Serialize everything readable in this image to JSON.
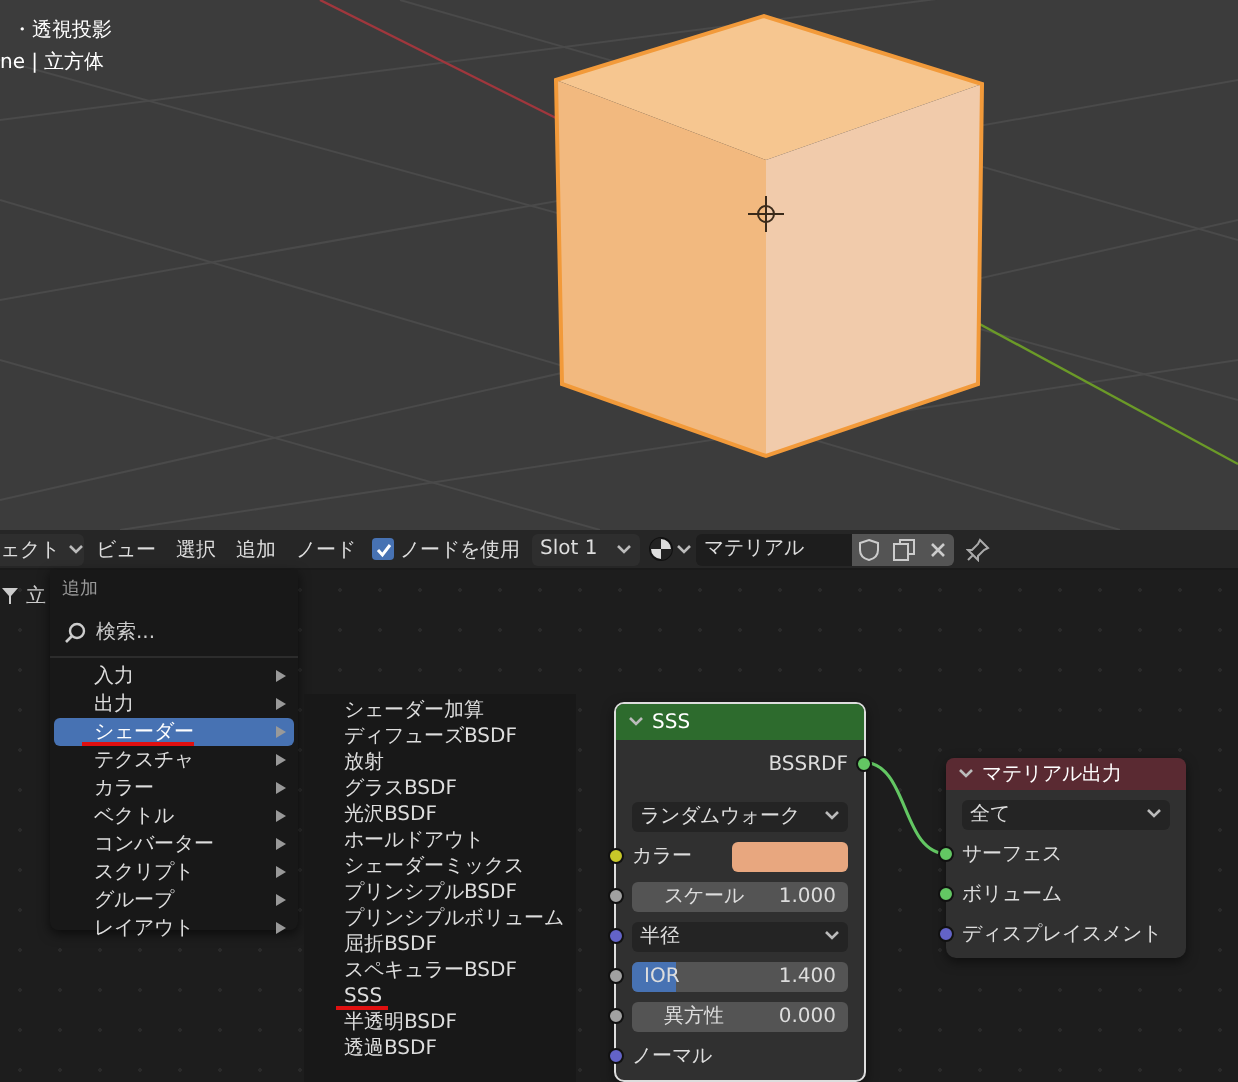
{
  "viewport": {
    "overlay_lines": [
      "・透視投影",
      "ne | 立方体"
    ]
  },
  "header": {
    "editor_type": "ェクト",
    "menus": [
      "ビュー",
      "選択",
      "追加",
      "ノード"
    ],
    "use_nodes": {
      "label": "ノードを使用",
      "checked": true
    },
    "slot": "Slot 1",
    "material": "マテリアル"
  },
  "side_label": "立",
  "add_menu": {
    "title": "追加",
    "search_placeholder": "検索...",
    "items": [
      {
        "label": "入力",
        "selected": false,
        "underlined": false
      },
      {
        "label": "出力",
        "selected": false,
        "underlined": false
      },
      {
        "label": "シェーダー",
        "selected": true,
        "underlined": true
      },
      {
        "label": "テクスチャ",
        "selected": false,
        "underlined": false
      },
      {
        "label": "カラー",
        "selected": false,
        "underlined": false
      },
      {
        "label": "ベクトル",
        "selected": false,
        "underlined": false
      },
      {
        "label": "コンバーター",
        "selected": false,
        "underlined": false
      },
      {
        "label": "スクリプト",
        "selected": false,
        "underlined": false
      },
      {
        "label": "グループ",
        "selected": false,
        "underlined": false
      },
      {
        "label": "レイアウト",
        "selected": false,
        "underlined": false
      }
    ]
  },
  "shader_submenu": {
    "items": [
      {
        "label": "シェーダー加算",
        "underlined": false
      },
      {
        "label": "ディフューズBSDF",
        "underlined": false
      },
      {
        "label": "放射",
        "underlined": false
      },
      {
        "label": "グラスBSDF",
        "underlined": false
      },
      {
        "label": "光沢BSDF",
        "underlined": false
      },
      {
        "label": "ホールドアウト",
        "underlined": false
      },
      {
        "label": "シェーダーミックス",
        "underlined": false
      },
      {
        "label": "プリンシプルBSDF",
        "underlined": false
      },
      {
        "label": "プリンシプルボリューム",
        "underlined": false
      },
      {
        "label": "屈折BSDF",
        "underlined": false
      },
      {
        "label": "スペキュラーBSDF",
        "underlined": false
      },
      {
        "label": "SSS",
        "underlined": true
      },
      {
        "label": "半透明BSDF",
        "underlined": false
      },
      {
        "label": "透過BSDF",
        "underlined": false
      }
    ]
  },
  "nodes": [
    {
      "title": "SSS",
      "color": "#2d6b2d",
      "rows": [
        {
          "kind": "output",
          "label": "BSSRDF",
          "color": "#63c763"
        },
        {
          "kind": "dropdown",
          "label": "ランダムウォーク"
        },
        {
          "kind": "swatch",
          "label": "カラー",
          "color": "#c7c729",
          "swatch": {
            "color": "#e8a77f"
          }
        },
        {
          "kind": "value",
          "label": "スケール",
          "value": "1.000",
          "level": 0,
          "color": "#a1a1a1"
        },
        {
          "kind": "enum",
          "label": "半径",
          "color": "#6363c7"
        },
        {
          "kind": "value",
          "label": "IOR",
          "value": "1.400",
          "level": 0.2,
          "color": "#a1a1a1"
        },
        {
          "kind": "value",
          "label": "異方性",
          "value": "0.000",
          "level": 0,
          "color": "#a1a1a1"
        },
        {
          "kind": "input",
          "label": "ノーマル",
          "color": "#6363c7"
        }
      ]
    },
    {
      "title": "マテリアル出力",
      "color": "#5a2a32",
      "rows": [
        {
          "kind": "dropdown",
          "label": "全て"
        },
        {
          "kind": "input",
          "label": "サーフェス",
          "color": "#63c763"
        },
        {
          "kind": "input",
          "label": "ボリューム",
          "color": "#63c763"
        },
        {
          "kind": "input",
          "label": "ディスプレイスメント",
          "color": "#6363c7"
        }
      ]
    }
  ]
}
